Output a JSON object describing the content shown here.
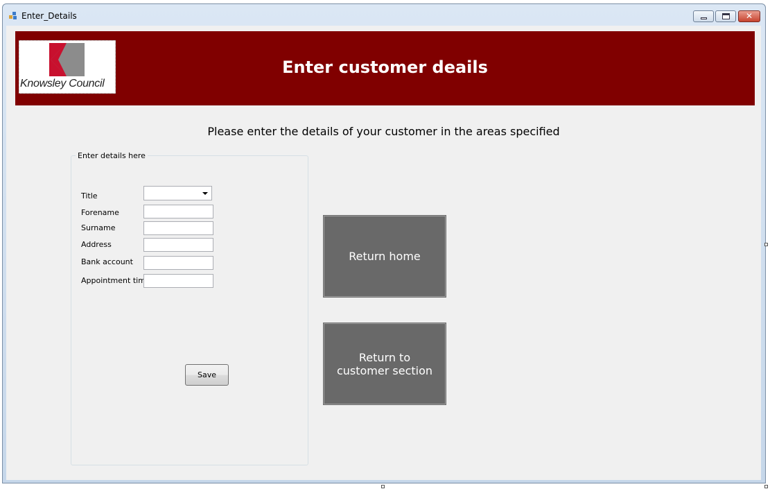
{
  "window": {
    "title": "Enter_Details"
  },
  "banner": {
    "logo_text": "Knowsley Council",
    "title": "Enter customer deails",
    "background_color": "#800000"
  },
  "instruction": "Please enter the details of your customer in the areas specified",
  "details_group": {
    "legend": "Enter details here",
    "fields": {
      "title": {
        "label": "Title",
        "value": ""
      },
      "forename": {
        "label": "Forename",
        "value": ""
      },
      "surname": {
        "label": "Surname",
        "value": ""
      },
      "address": {
        "label": "Address",
        "value": ""
      },
      "bank_account": {
        "label": "Bank account",
        "value": ""
      },
      "appointment_time": {
        "label": "Appointment time",
        "value": ""
      }
    },
    "save_label": "Save"
  },
  "buttons": {
    "return_home": "Return home",
    "return_customer": "Return to customer section",
    "button_color": "#696969"
  },
  "icons": {
    "app_icon": "form-icon",
    "minimize": "minimize-icon",
    "maximize": "maximize-icon",
    "close": "close-icon",
    "dropdown": "chevron-down-icon"
  }
}
